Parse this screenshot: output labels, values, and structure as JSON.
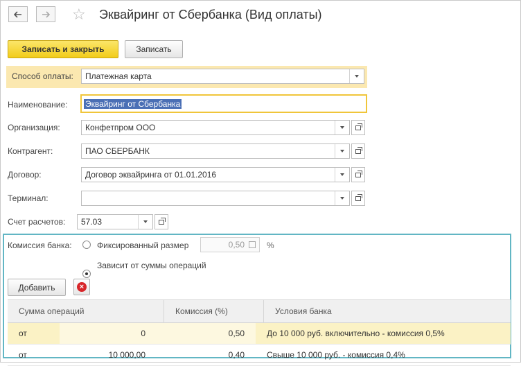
{
  "window": {
    "title": "Эквайринг от Сбербанка (Вид оплаты)",
    "back_icon": "arrow-left-icon",
    "forward_icon": "arrow-right-icon",
    "favorite_icon": "star-icon"
  },
  "toolbar": {
    "save_close_label": "Записать и закрыть",
    "save_label": "Записать"
  },
  "form": {
    "payment_method_label": "Способ оплаты:",
    "payment_method_value": "Платежная карта",
    "name_label": "Наименование:",
    "name_value": "Эквайринг от Сбербанка",
    "organization_label": "Организация:",
    "organization_value": "Конфетпром ООО",
    "counterparty_label": "Контрагент:",
    "counterparty_value": "ПАО СБЕРБАНК",
    "contract_label": "Договор:",
    "contract_value": "Договор эквайринга от 01.01.2016",
    "terminal_label": "Терминал:",
    "terminal_value": "",
    "account_label": "Счет расчетов:",
    "account_value": "57.03"
  },
  "commission": {
    "label": "Комиссия банка:",
    "fixed_label": "Фиксированный размер",
    "fixed_value": "0,50",
    "percent_sign": "%",
    "depends_label": "Зависит от суммы операций",
    "selected": "depends",
    "add_button": "Добавить"
  },
  "table": {
    "headers": [
      "Сумма операций",
      "Комиссия (%)",
      "Условия банка"
    ],
    "rows": [
      {
        "prefix": "от",
        "amount": "0",
        "commission": "0,50",
        "conditions": "До 10 000 руб. включительно - комиссия 0,5%"
      },
      {
        "prefix": "от",
        "amount": "10 000,00",
        "commission": "0,40",
        "conditions": "Свыше 10 000 руб. - комиссия 0,4%"
      }
    ]
  },
  "colors": {
    "accent_yellow": "#f2cc1a",
    "highlight_band": "#fbe8b0",
    "commission_frame": "#62b6c4",
    "selected_row": "#fbf2c5",
    "selection_text_bg": "#4a6fb5"
  }
}
